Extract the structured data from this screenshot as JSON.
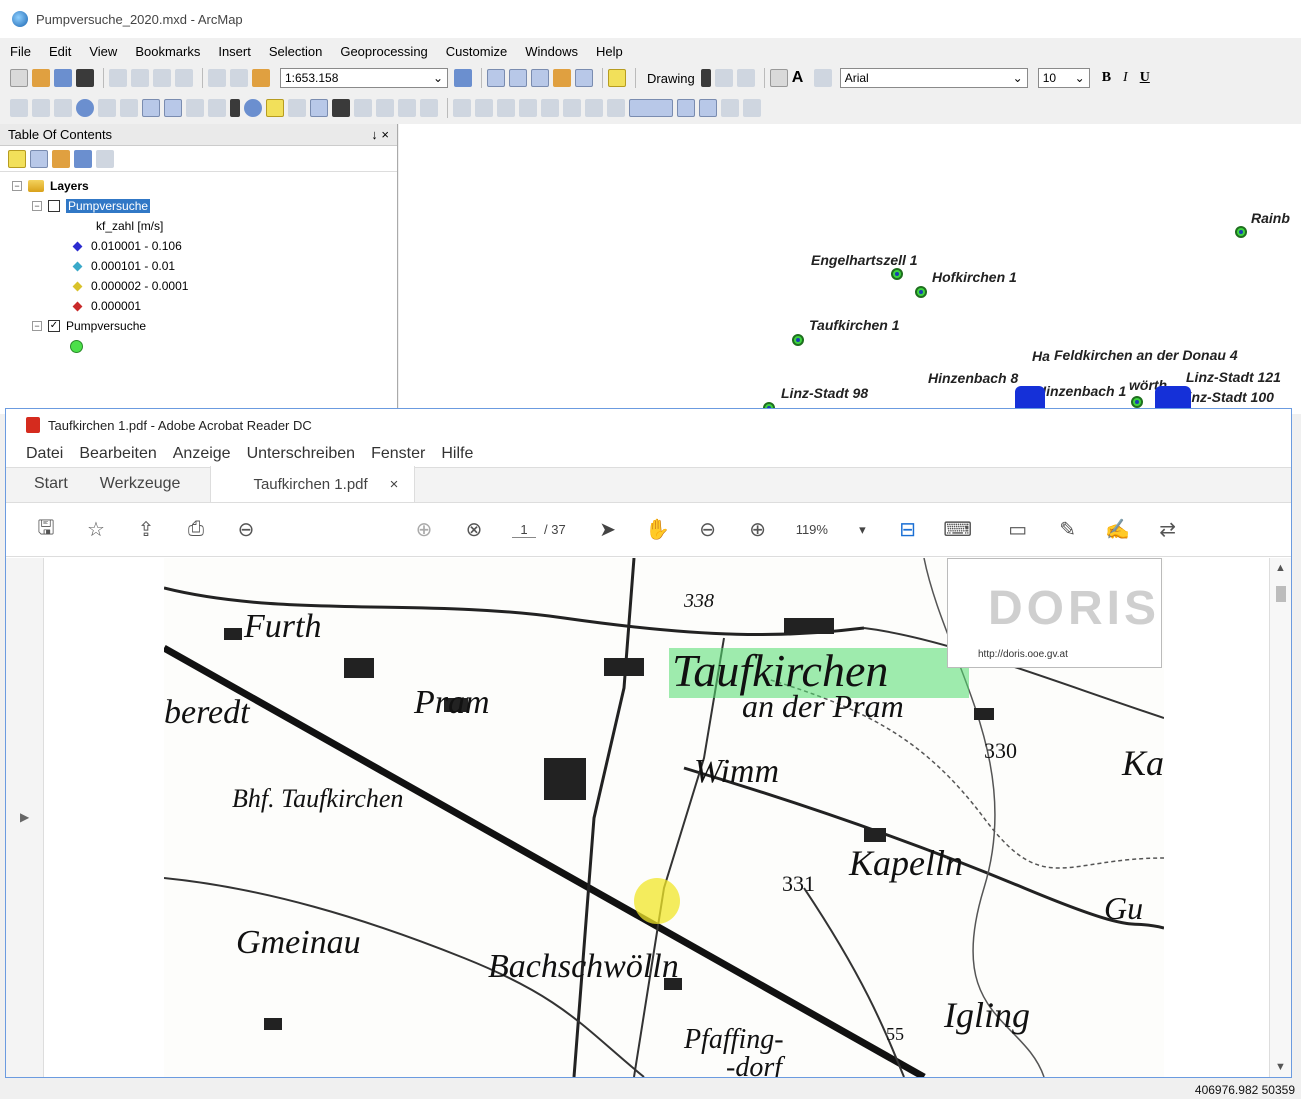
{
  "arcmap": {
    "title": "Pumpversuche_2020.mxd - ArcMap",
    "menu": [
      "File",
      "Edit",
      "View",
      "Bookmarks",
      "Insert",
      "Selection",
      "Geoprocessing",
      "Customize",
      "Windows",
      "Help"
    ],
    "scale": "1:653.158",
    "drawing_label": "Drawing",
    "font_name": "Arial",
    "font_size": "10",
    "bold": "B",
    "italic": "I",
    "underline": "U",
    "toc": {
      "title": "Table Of Contents",
      "pin": "↓ ×",
      "layers_root": "Layers",
      "group1": "Pumpversuche",
      "field": "kf_zahl [m/s]",
      "classes": [
        {
          "label": "0.010001 - 0.106",
          "color": "#2b2bd0"
        },
        {
          "label": "0.000101 - 0.01",
          "color": "#3aa9c9"
        },
        {
          "label": "0.000002 - 0.0001",
          "color": "#d9c22a"
        },
        {
          "label": "0.000001",
          "color": "#c92a2a"
        }
      ],
      "group2": "Pumpversuche"
    },
    "map_labels": [
      "Rainb",
      "Engelhartszell 1",
      "Hofkirchen 1",
      "Taufkirchen 1",
      "Feldkirchen an der Donau 4",
      "Ha",
      "Hinzenbach 8",
      "Hinzenbach 1",
      "Linz-Stadt 98",
      "Linz-Stadt 121",
      "Linz-Stadt 100",
      "wörth"
    ],
    "coords": "406976.982  50359"
  },
  "acrobat": {
    "title": "Taufkirchen 1.pdf - Adobe Acrobat Reader DC",
    "menu": [
      "Datei",
      "Bearbeiten",
      "Anzeige",
      "Unterschreiben",
      "Fenster",
      "Hilfe"
    ],
    "tab_start": "Start",
    "tab_tools": "Werkzeuge",
    "tab_doc": "Taufkirchen 1.pdf",
    "tab_close": "×",
    "page_current": "1",
    "page_total": "/ 37",
    "zoom": "119%",
    "map_labels": {
      "furth": "Furth",
      "beredt": "beredt",
      "pram": "Pram",
      "bhf": "Bhf. Taufkirchen",
      "taufkirchen": "Taufkirchen",
      "an_der_pram": "an der Pram",
      "wimm": "Wimm",
      "n330": "330",
      "n338": "338",
      "ka": "Ka",
      "kapelln": "Kapelln",
      "n331": "331",
      "gu": "Gu",
      "gmeinau": "Gmeinau",
      "bachschwolln": "Bachschwölln",
      "igling": "Igling",
      "pfaffing": "Pfaffing-",
      "dorf": "-dorf",
      "n55": "55"
    },
    "doris_logo": "DORIS",
    "doris_url": "http://doris.ooe.gv.at"
  }
}
